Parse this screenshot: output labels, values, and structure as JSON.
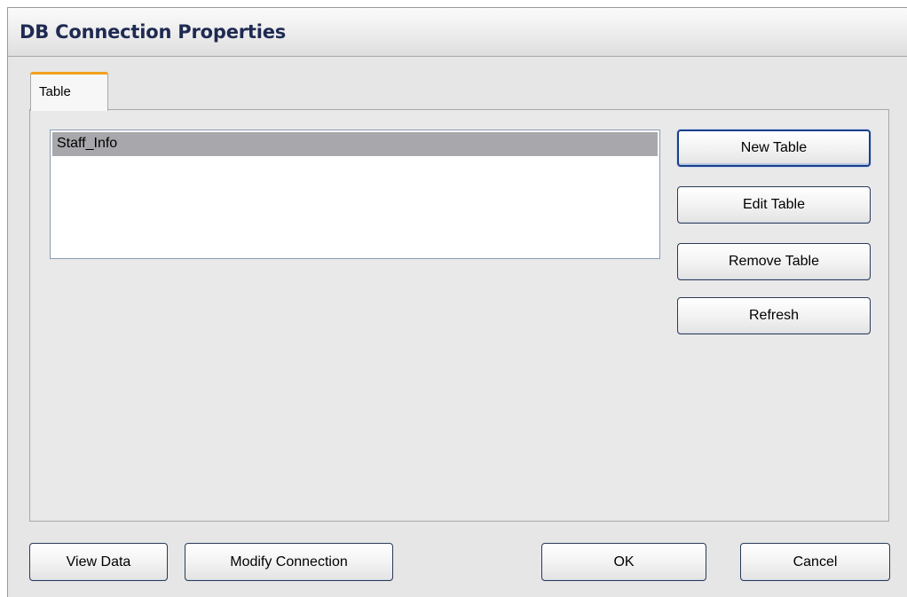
{
  "window": {
    "title": "DB Connection Properties"
  },
  "tabs": [
    {
      "label": "Table",
      "active": true
    }
  ],
  "table_list": {
    "items": [
      {
        "label": "Staff_Info",
        "selected": true
      }
    ]
  },
  "side_buttons": {
    "new_table": "New Table",
    "edit_table": "Edit Table",
    "remove_table": "Remove Table",
    "refresh": "Refresh"
  },
  "footer_buttons": {
    "view_data": "View Data",
    "modify_connection": "Modify Connection",
    "ok": "OK",
    "cancel": "Cancel"
  },
  "colors": {
    "title_text": "#1e2a52",
    "tab_accent": "#f2a01e",
    "selection": "#a8a8ac",
    "button_border": "#2a3a5a"
  }
}
